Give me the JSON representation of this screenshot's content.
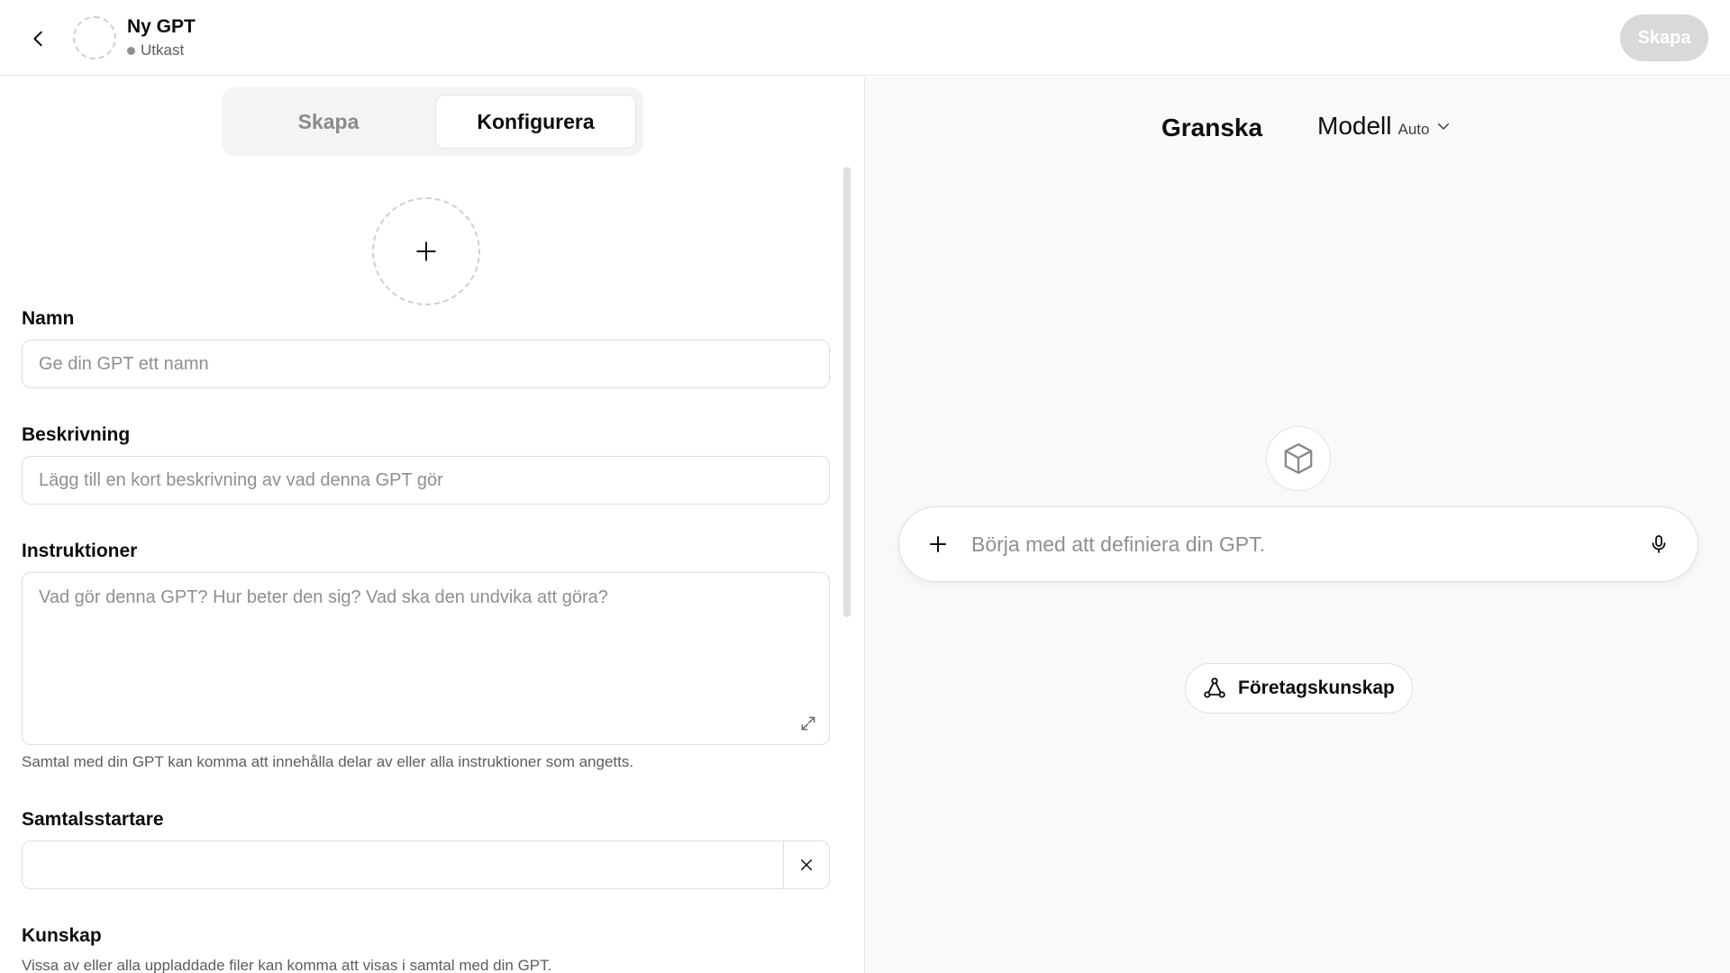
{
  "header": {
    "title": "Ny GPT",
    "status": "Utkast",
    "create_label": "Skapa"
  },
  "editor": {
    "tabs": [
      {
        "label": "Skapa",
        "active": false
      },
      {
        "label": "Konfigurera",
        "active": true
      }
    ],
    "name": {
      "label": "Namn",
      "placeholder": "Ge din GPT ett namn",
      "value": ""
    },
    "description": {
      "label": "Beskrivning",
      "placeholder": "Lägg till en kort beskrivning av vad denna GPT gör",
      "value": ""
    },
    "instructions": {
      "label": "Instruktioner",
      "placeholder": "Vad gör denna GPT? Hur beter den sig? Vad ska den undvika att göra?",
      "value": "",
      "help": "Samtal med din GPT kan komma att innehålla delar av eller alla instruktioner som angetts."
    },
    "conversation_starters": {
      "label": "Samtalsstartare",
      "value": ""
    },
    "knowledge": {
      "label": "Kunskap",
      "help": "Vissa av eller alla uppladdade filer kan komma att visas i samtal med din GPT."
    }
  },
  "preview": {
    "title": "Granska",
    "model_label": "Modell",
    "model_value": "Auto",
    "composer_placeholder": "Börja med att definiera din GPT.",
    "chip_label": "Företagskunskap"
  },
  "icons": {
    "back": "chevron-left-icon",
    "add": "plus-icon",
    "expand": "expand-icon",
    "clear": "close-icon",
    "chevron": "chevron-down-icon",
    "cube": "cube-icon",
    "mic": "microphone-icon",
    "knowledge": "nodes-icon"
  },
  "colors": {
    "create_button_bg": "#d9d9d9",
    "preview_bg": "#f9f9f9",
    "border": "#e5e5e5"
  }
}
